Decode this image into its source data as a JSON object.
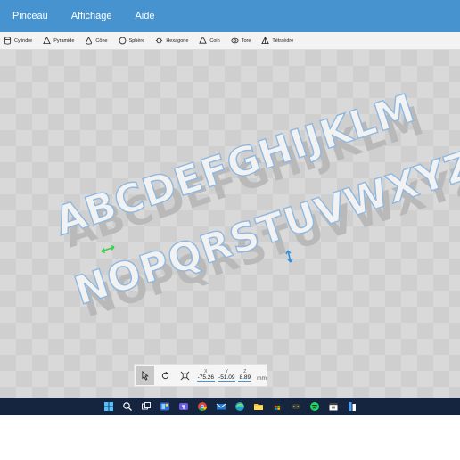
{
  "menubar": {
    "items": [
      "Pinceau",
      "Affichage",
      "Aide"
    ]
  },
  "toolbar": {
    "items": [
      {
        "label": "Cylindre",
        "icon": "cylinder-icon"
      },
      {
        "label": "Pyramide",
        "icon": "pyramid-icon"
      },
      {
        "label": "Cône",
        "icon": "cone-icon"
      },
      {
        "label": "Sphère",
        "icon": "sphere-icon"
      },
      {
        "label": "Hexagone",
        "icon": "hexagon-icon"
      },
      {
        "label": "Coin",
        "icon": "wedge-icon"
      },
      {
        "label": "Tore",
        "icon": "torus-icon"
      },
      {
        "label": "Tétraèdre",
        "icon": "tetrahedron-icon"
      }
    ]
  },
  "scene": {
    "line1": "ABCDEFGHIJKLM",
    "line2": "NOPQRSTUVWXYZ",
    "model_color": "#f2f2f2",
    "selection_color": "#8fb8e0",
    "gizmo_green": "#35d14a",
    "gizmo_blue": "#2b8fe0"
  },
  "transform": {
    "x_label": "X",
    "y_label": "Y",
    "z_label": "Z",
    "x_value": "-75.26",
    "y_value": "-51.09",
    "z_value": "8.89",
    "unit": "mm"
  },
  "taskbar": {
    "icons": [
      "start-icon",
      "search-icon",
      "task-view-icon",
      "widgets-icon",
      "teams-icon",
      "chrome-icon",
      "mail-icon",
      "edge-icon",
      "file-explorer-icon",
      "store-icon",
      "xbox-icon",
      "spotify-icon",
      "calendar-icon",
      "paint3d-icon"
    ]
  },
  "colors": {
    "menubar_bg": "#4793cf",
    "taskbar_bg": "#15253f",
    "accent": "#4793cf"
  }
}
